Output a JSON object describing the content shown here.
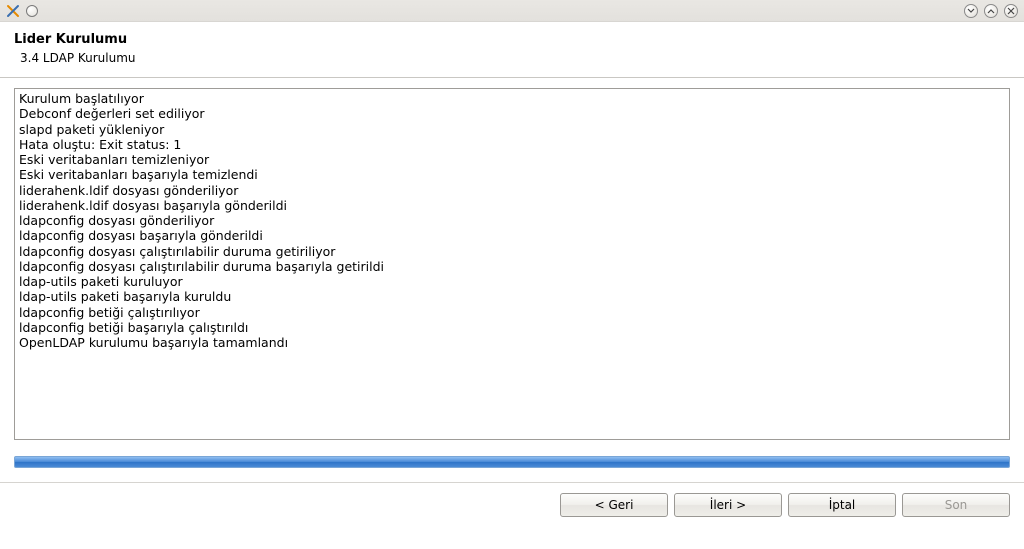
{
  "titlebar": {
    "app_icon_name": "x-app-icon",
    "controls": {
      "minimize": "minimize",
      "maximize": "maximize",
      "close": "close"
    }
  },
  "header": {
    "title": "Lider Kurulumu",
    "subtitle": "3.4 LDAP Kurulumu"
  },
  "log": {
    "lines": [
      "Kurulum başlatılıyor",
      "Debconf değerleri set ediliyor",
      "slapd paketi yükleniyor",
      "Hata oluştu: Exit status: 1",
      "Eski veritabanları temizleniyor",
      "Eski veritabanları başarıyla temizlendi",
      "liderahenk.ldif dosyası gönderiliyor",
      "liderahenk.ldif dosyası başarıyla gönderildi",
      "ldapconfig dosyası gönderiliyor",
      "ldapconfig dosyası başarıyla gönderildi",
      "ldapconfig dosyası çalıştırılabilir duruma getiriliyor",
      "ldapconfig dosyası çalıştırılabilir duruma başarıyla getirildi",
      "ldap-utils paketi kuruluyor",
      "ldap-utils paketi başarıyla kuruldu",
      "ldapconfig betiği çalıştırılıyor",
      "ldapconfig betiği başarıyla çalıştırıldı",
      "OpenLDAP kurulumu başarıyla tamamlandı"
    ]
  },
  "progress": {
    "percent": 100
  },
  "buttons": {
    "back": "< Geri",
    "next": "İleri >",
    "cancel": "İptal",
    "finish": "Son",
    "finish_disabled": true
  }
}
